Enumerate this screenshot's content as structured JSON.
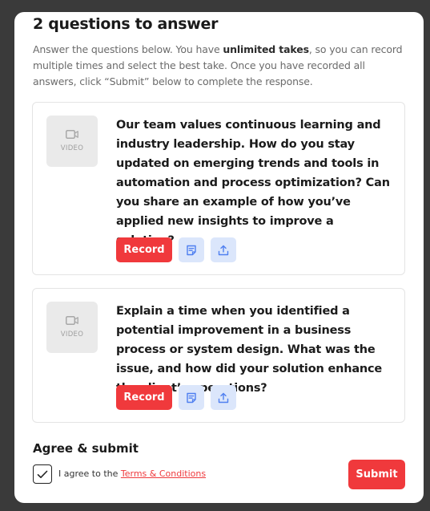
{
  "header": {
    "title": "2 questions to answer",
    "intro_prefix": "Answer the questions below. You have ",
    "intro_bold": "unlimited takes",
    "intro_suffix": ", so you can record multiple times and select the best take. Once you have recorded all answers, click “Submit” below to complete the response."
  },
  "questions": [
    {
      "thumb_label": "VIDEO",
      "text": "Our team values continuous learning and industry leadership. How do you stay updated on emerging trends and tools in automation and process optimization? Can you share an example of how you’ve applied new insights to improve a solution?",
      "record_label": "Record",
      "notes_icon": "notes-icon",
      "upload_icon": "upload-icon"
    },
    {
      "thumb_label": "VIDEO",
      "text": "Explain a time when you identified a potential improvement in a business process or system design. What was the issue, and how did your solution enhance the client’s operations?",
      "record_label": "Record",
      "notes_icon": "notes-icon",
      "upload_icon": "upload-icon"
    }
  ],
  "agree": {
    "title": "Agree & submit",
    "checked": true,
    "text_prefix": "I agree to the ",
    "link_text": "Terms & Conditions",
    "submit_label": "Submit"
  },
  "colors": {
    "accent_red": "#f0393c",
    "icon_button_bg": "#dbe6fb",
    "icon_blue": "#4f7ff0",
    "thumb_bg": "#eaeaea"
  }
}
